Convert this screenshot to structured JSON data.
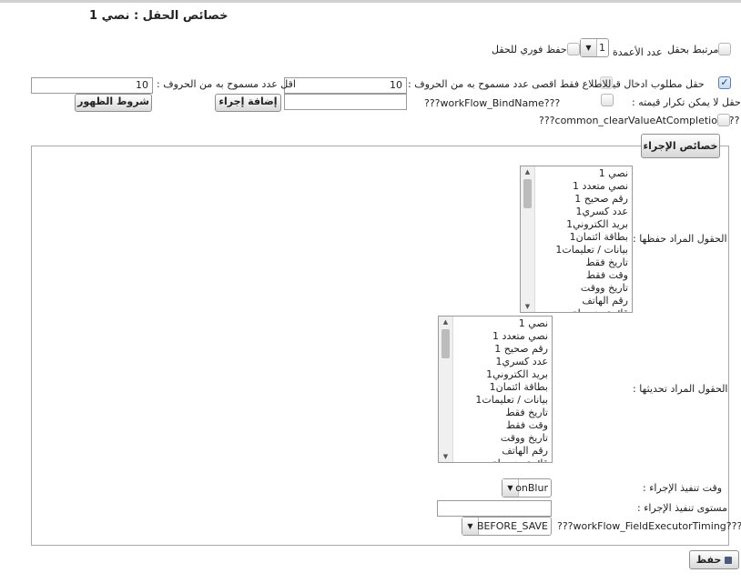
{
  "page": {
    "title": "خصائص الحقل : نصي 1"
  },
  "row1": {
    "linked_label": "مرتبط بحقل",
    "columns_label": "عدد الأعمدة",
    "columns_value": "1",
    "instant_save_label": "حفظ فوري للحقل"
  },
  "row2": {
    "required_label": "حقل مطلوب ادخال قيمة",
    "required_checked": true,
    "readonly_label": "للاطلاع فقط",
    "max_chars_label": "اقصى عدد مسموح به من الحروف :",
    "max_chars_value": "10",
    "min_chars_label": "اقل عدد مسموح به من الحروف :",
    "min_chars_value": "10"
  },
  "row3": {
    "unique_label": "حقل لا يمكن تكرار قيمته :",
    "bind_label": "???workFlow_BindName???",
    "add_action_button": "إضافة إجراء",
    "visibility_conditions_button": "شروط الظهور"
  },
  "row4": {
    "clear_value_label": "???common_clearValueAtCompletion???"
  },
  "actions": {
    "legend": "خصائص الإجراء",
    "fields_to_save_label": "الحقول المراد حفظها :",
    "fields_to_update_label": "الحقول المراد تحديثها :",
    "fields_options": [
      "نصي 1",
      "نصي متعدد 1",
      "رقم صحيح 1",
      "عدد كسري1",
      "بريد الكتروني1",
      "بطاقة ائتمان1",
      "بيانات / تعليمات1",
      "تاريخ فقط",
      "وقت فقط",
      "تاريخ ووقت",
      "رقم الهاتف",
      "قائمة منسدلة"
    ],
    "exec_time_label": "وقت تنفيذ الإجراء :",
    "exec_time_value": "onBlur",
    "exec_level_label": "مستوى تنفيذ الإجراء :",
    "exec_level_value": "",
    "timing_label": "???workFlow_FieldExecutorTiming???",
    "timing_value": "BEFORE_SAVE"
  },
  "footer": {
    "save_button": "حفظ"
  },
  "icons": {
    "combo_arrow": "chevron-down-icon",
    "checkmark": "checkmark-icon",
    "save": "floppy-disk-icon"
  }
}
